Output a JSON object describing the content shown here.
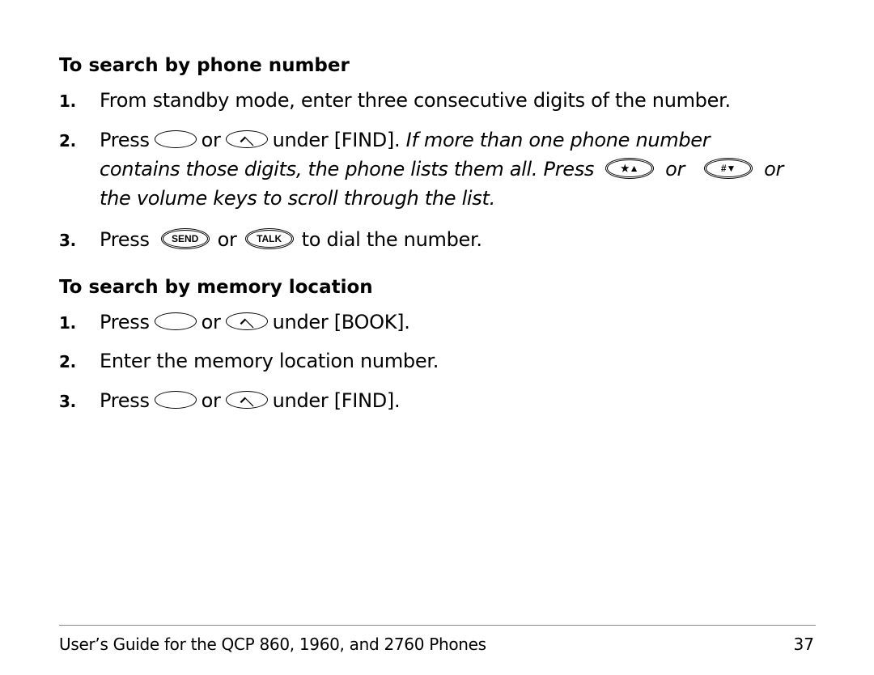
{
  "section1": {
    "heading": "To search by phone number",
    "steps": [
      {
        "num": "1.",
        "text": "From standby mode, enter three consecutive digits of the number."
      },
      {
        "num": "2.",
        "press": "Press",
        "or": "or",
        "after": "under [FIND].",
        "italic_a": "If more than one phone number",
        "italic_b": "contains those digits, the phone lists them all. Press",
        "italic_or": "or",
        "italic_or2": "or",
        "italic_c": "the volume keys to scroll through the list."
      },
      {
        "num": "3.",
        "press": "Press",
        "or": "or",
        "after": "to dial the number.",
        "key1": "SEND",
        "key2": "TALK"
      }
    ],
    "key_star": "★▲",
    "key_hash": "#▼"
  },
  "section2": {
    "heading": "To search by memory location",
    "steps": [
      {
        "num": "1.",
        "press": "Press",
        "or": "or",
        "after": "under [BOOK]."
      },
      {
        "num": "2.",
        "text": "Enter the memory location number."
      },
      {
        "num": "3.",
        "press": "Press",
        "or": "or",
        "after": "under [FIND]."
      }
    ]
  },
  "footer": {
    "title": "User’s Guide for the QCP 860, 1960, and 2760 Phones",
    "page": "37"
  }
}
